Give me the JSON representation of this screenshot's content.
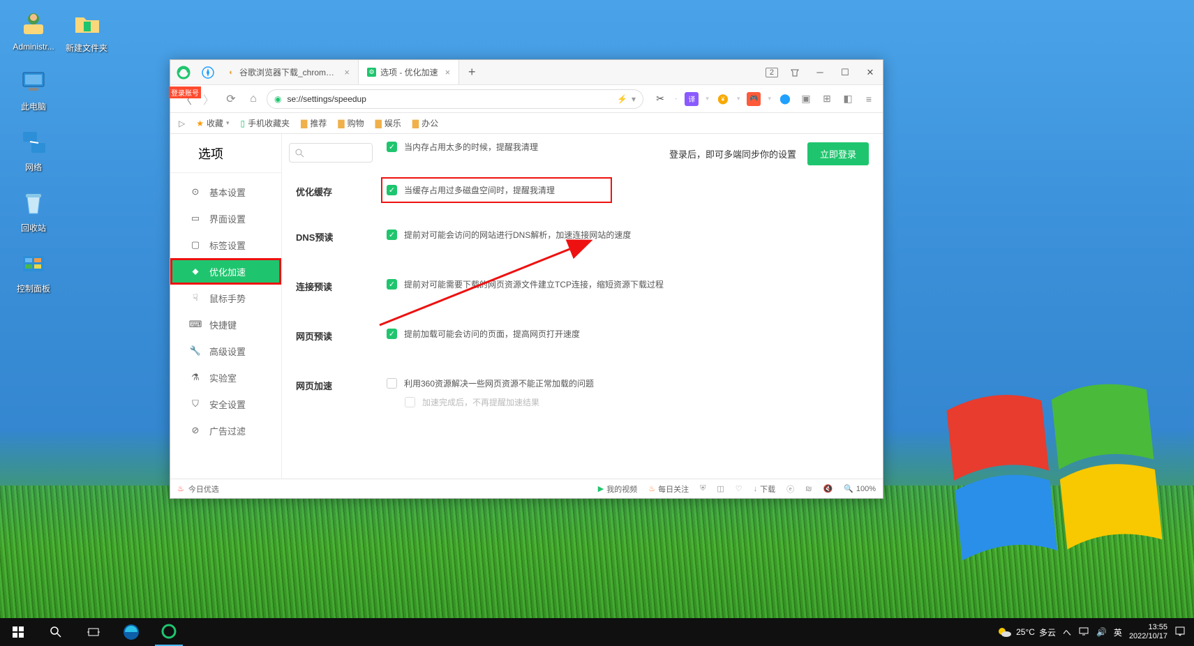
{
  "desktop": {
    "icons": [
      {
        "label": "Administr...",
        "icon": "user"
      },
      {
        "label": "新建文件夹",
        "icon": "folder"
      },
      {
        "label": "此电脑",
        "icon": "pc"
      },
      {
        "label": "网络",
        "icon": "network"
      },
      {
        "label": "回收站",
        "icon": "trash"
      },
      {
        "label": "控制面板",
        "icon": "panel"
      }
    ]
  },
  "browser": {
    "login_tag": "登录账号",
    "tabs": [
      {
        "title": "谷歌浏览器下载_chrome浏览器官",
        "favcolor": "#e8a33d",
        "favtxt": "◐"
      },
      {
        "title": "选项 - 优化加速",
        "favcolor": "#1fc56e",
        "favtxt": "▧",
        "active": true
      }
    ],
    "tab_count_badge": "2",
    "url": "se://settings/speedup",
    "bookmarks_bar": {
      "fav_label": "收藏",
      "phone_label": "手机收藏夹",
      "folders": [
        "推荐",
        "购物",
        "娱乐",
        "办公"
      ]
    },
    "toolbar_icons": [
      "scissors",
      "translate",
      "coin",
      "game",
      "paw",
      "ext",
      "grid",
      "rec",
      "menu"
    ],
    "window_controls": [
      "min",
      "max",
      "close"
    ]
  },
  "options": {
    "title": "选项",
    "search_placeholder": "",
    "sidebar": [
      {
        "label": "基本设置",
        "icon": "⚙"
      },
      {
        "label": "界面设置",
        "icon": "▭"
      },
      {
        "label": "标签设置",
        "icon": "▢"
      },
      {
        "label": "优化加速",
        "icon": "⚡",
        "active": true
      },
      {
        "label": "鼠标手势",
        "icon": "☟"
      },
      {
        "label": "快捷键",
        "icon": "⌨"
      },
      {
        "label": "高级设置",
        "icon": "🔧"
      },
      {
        "label": "实验室",
        "icon": "⚗"
      },
      {
        "label": "安全设置",
        "icon": "⛉"
      },
      {
        "label": "广告过滤",
        "icon": "⊘"
      }
    ],
    "sync_text": "登录后，即可多端同步你的设置",
    "login_btn": "立即登录",
    "sections": [
      {
        "label": "",
        "items": [
          {
            "checked": true,
            "text": "当内存占用太多的时候，提醒我清理"
          }
        ]
      },
      {
        "label": "优化缓存",
        "items": [
          {
            "checked": true,
            "text": "当缓存占用过多磁盘空间时，提醒我清理",
            "highlight": true
          }
        ]
      },
      {
        "label": "DNS预读",
        "items": [
          {
            "checked": true,
            "text": "提前对可能会访问的网站进行DNS解析，加速连接网站的速度"
          }
        ]
      },
      {
        "label": "连接预读",
        "items": [
          {
            "checked": true,
            "text": "提前对可能需要下载的网页资源文件建立TCP连接，缩短资源下载过程"
          }
        ]
      },
      {
        "label": "网页预读",
        "items": [
          {
            "checked": true,
            "text": "提前加载可能会访问的页面，提高网页打开速度"
          }
        ]
      },
      {
        "label": "网页加速",
        "items": [
          {
            "checked": false,
            "text": "利用360资源解决一些网页资源不能正常加载的问题"
          },
          {
            "checked": false,
            "text": "加速完成后，不再提醒加速结果",
            "disabled": true,
            "indent": true
          }
        ]
      }
    ]
  },
  "statusbar": {
    "today": "今日优选",
    "video": "我的视频",
    "daily": "每日关注",
    "download": "下载",
    "zoom": "100%"
  },
  "taskbar": {
    "weather_temp": "25°C",
    "weather_text": "多云",
    "ime": "英",
    "time": "13:55",
    "date": "2022/10/17"
  }
}
